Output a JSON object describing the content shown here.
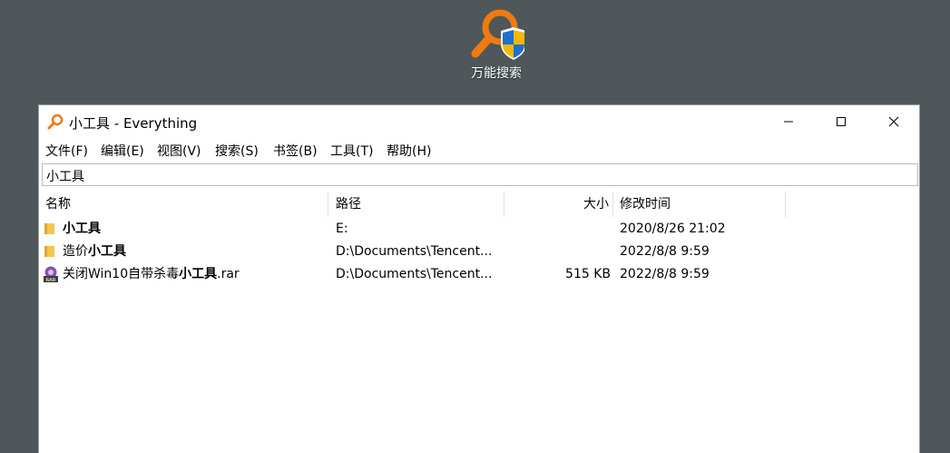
{
  "desktop": {
    "icon_label": "万能搜索"
  },
  "window": {
    "title": "小工具 - Everything",
    "controls": {
      "minimize": "—",
      "maximize": "☐",
      "close": "✕"
    }
  },
  "menu": [
    {
      "label": "文件(F)"
    },
    {
      "label": "编辑(E)"
    },
    {
      "label": "视图(V)"
    },
    {
      "label": "搜索(S)"
    },
    {
      "label": "书签(B)"
    },
    {
      "label": "工具(T)"
    },
    {
      "label": "帮助(H)"
    }
  ],
  "search": {
    "value": "小工具"
  },
  "columns": {
    "name": "名称",
    "path": "路径",
    "size": "大小",
    "modified": "修改时间"
  },
  "rows": [
    {
      "icon": "folder-icon",
      "name_prefix": "",
      "name_bold": "小工具",
      "name_suffix": "",
      "path": "E:",
      "size": "",
      "modified": "2020/8/26 21:02"
    },
    {
      "icon": "folder-icon",
      "name_prefix": "造价",
      "name_bold": "小工具",
      "name_suffix": "",
      "path": "D:\\Documents\\Tencent...",
      "size": "",
      "modified": "2022/8/8 9:59"
    },
    {
      "icon": "rar-archive-icon",
      "name_prefix": "关闭Win10自带杀毒",
      "name_bold": "小工具",
      "name_suffix": ".rar",
      "path": "D:\\Documents\\Tencent...",
      "size": "515 KB",
      "modified": "2022/8/8 9:59"
    }
  ],
  "colors": {
    "desktop_bg": "#4f575a",
    "accent_orange": "#f07a12",
    "folder_yellow": "#f5c64a"
  }
}
